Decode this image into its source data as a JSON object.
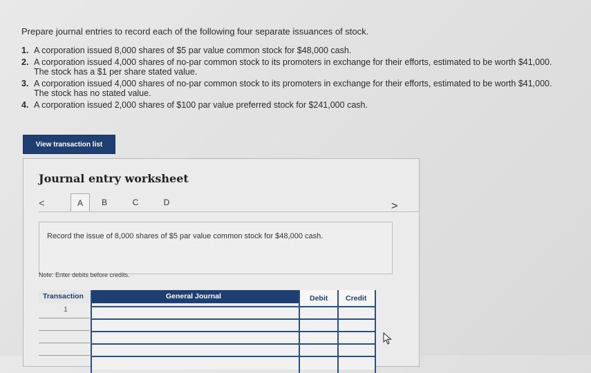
{
  "problem": {
    "intro": "Prepare journal entries to record each of the following four separate issuances of stock.",
    "items": [
      {
        "num": "1.",
        "text": "A corporation issued 8,000 shares of $5 par value common stock for $48,000 cash."
      },
      {
        "num": "2.",
        "text": "A corporation issued 4,000 shares of no-par common stock to its promoters in exchange for their efforts, estimated to be worth $41,000. The stock has a $1 per share stated value."
      },
      {
        "num": "3.",
        "text": "A corporation issued 4,000 shares of no-par common stock to its promoters in exchange for their efforts, estimated to be worth $41,000. The stock has no stated value."
      },
      {
        "num": "4.",
        "text": "A corporation issued 2,000 shares of $100 par value preferred stock for $241,000 cash."
      }
    ]
  },
  "buttons": {
    "view_transaction_list": "View transaction list"
  },
  "worksheet": {
    "title": "Journal entry worksheet",
    "prev_arrow": "<",
    "next_arrow": ">",
    "tabs": [
      "A",
      "B",
      "C",
      "D"
    ],
    "instruction": "Record the issue of 8,000 shares of $5 par value common stock for $48,000 cash.",
    "note": "Note: Enter debits before credits.",
    "table": {
      "headers": {
        "transaction": "Transaction",
        "general_journal": "General Journal",
        "debit": "Debit",
        "credit": "Credit"
      },
      "first_transaction": "1"
    }
  },
  "colors": {
    "header_blue": "#1f3f73",
    "grid_blue": "#2a4e86"
  },
  "icons": {
    "cursor": "mouse-pointer-icon"
  }
}
